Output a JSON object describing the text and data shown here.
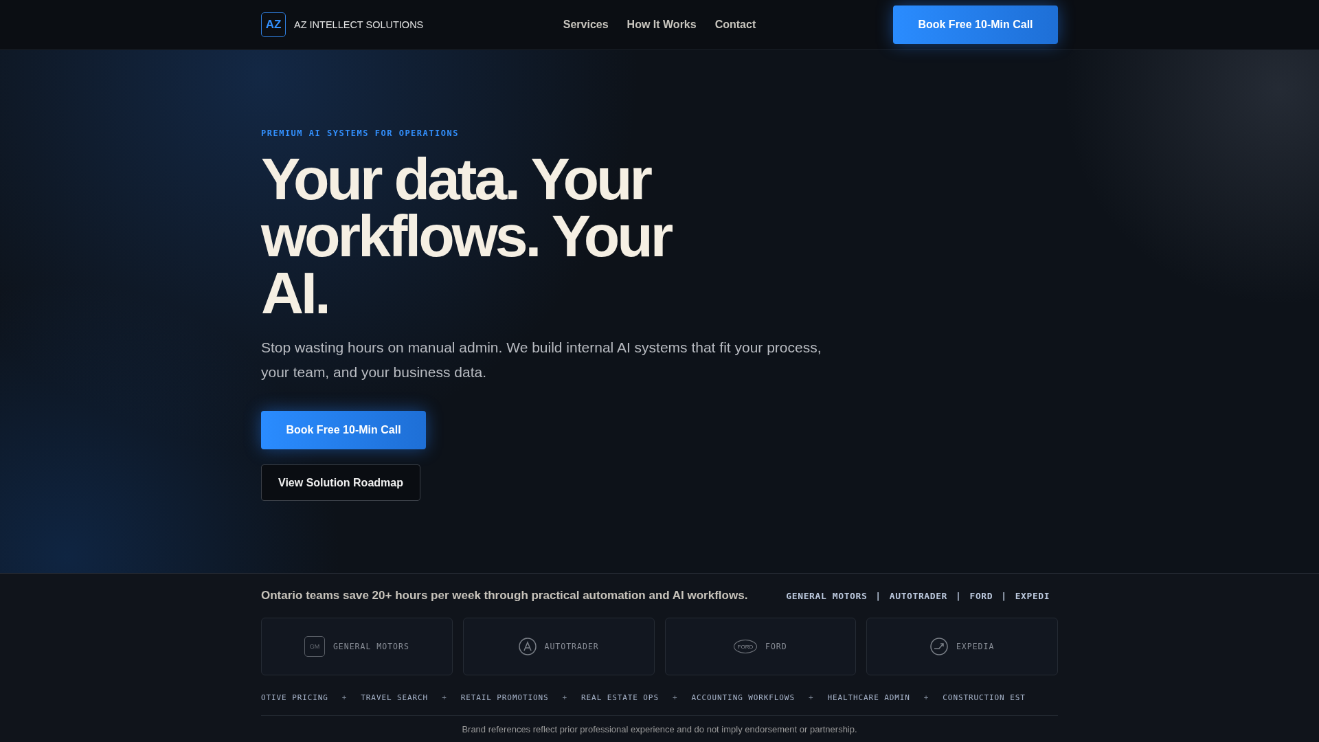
{
  "header": {
    "logo_mark": "AZ",
    "brand": "AZ INTELLECT SOLUTIONS",
    "nav": [
      "Services",
      "How It Works",
      "Contact"
    ],
    "cta": "Book Free 10-Min Call"
  },
  "hero": {
    "eyebrow": "PREMIUM AI SYSTEMS FOR OPERATIONS",
    "title_lines": [
      "Your data. Your",
      "workflows. Your",
      "AI."
    ],
    "subtitle": "Stop wasting hours on manual admin. We build internal AI systems that fit your process, your team, and your business data.",
    "primary_button": "Book Free 10-Min Call",
    "secondary_button": "View Solution Roadmap"
  },
  "ticker": {
    "statement": "Ontario teams save 20+ hours per week through practical automation and AI workflows.",
    "brands": [
      "GENERAL MOTORS",
      "AUTOTRADER",
      "FORD",
      "EXPEDI"
    ],
    "separator": "|"
  },
  "brand_cards": [
    {
      "kind": "square",
      "mark": "GM",
      "name": "GENERAL MOTORS"
    },
    {
      "kind": "letter-circle",
      "name": "AUTOTRADER"
    },
    {
      "kind": "oval",
      "mark": "FORD",
      "name": "FORD"
    },
    {
      "kind": "plane-circle",
      "name": "EXPEDIA"
    }
  ],
  "industries": {
    "items": [
      "OTIVE PRICING",
      "TRAVEL SEARCH",
      "RETAIL PROMOTIONS",
      "REAL ESTATE OPS",
      "ACCOUNTING WORKFLOWS",
      "HEALTHCARE ADMIN",
      "CONSTRUCTION EST"
    ],
    "separator": "+"
  },
  "disclaimer": "Brand references reflect prior professional experience and do not imply endorsement or partnership."
}
